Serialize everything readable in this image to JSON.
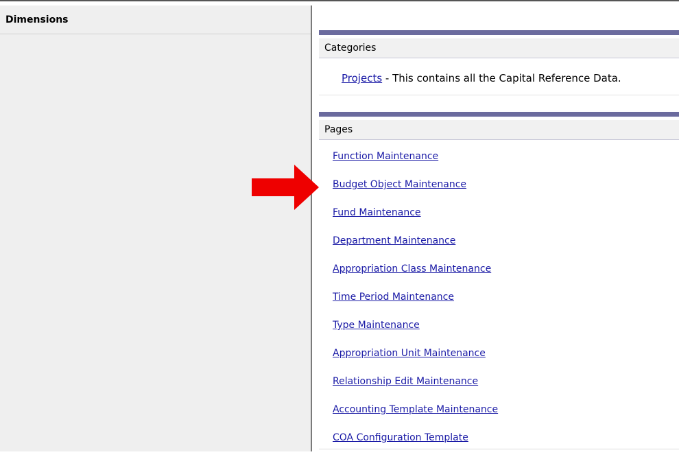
{
  "sidebar": {
    "title": "Dimensions"
  },
  "categories": {
    "header": "Categories",
    "items": [
      {
        "link": "Projects",
        "description": " - This contains all the Capital Reference Data."
      }
    ]
  },
  "pages": {
    "header": "Pages",
    "items": [
      "Function Maintenance",
      "Budget Object Maintenance",
      "Fund Maintenance",
      "Department Maintenance",
      "Appropriation Class Maintenance",
      "Time Period Maintenance",
      "Type Maintenance",
      "Appropriation Unit Maintenance",
      "Relationship Edit Maintenance",
      "Accounting Template Maintenance",
      "COA Configuration Template"
    ]
  },
  "colors": {
    "link": "#1a1aa6",
    "section_bar": "#6b6b9e",
    "arrow": "#ee0000"
  },
  "annotation": {
    "icon": "red-arrow-right-icon"
  }
}
